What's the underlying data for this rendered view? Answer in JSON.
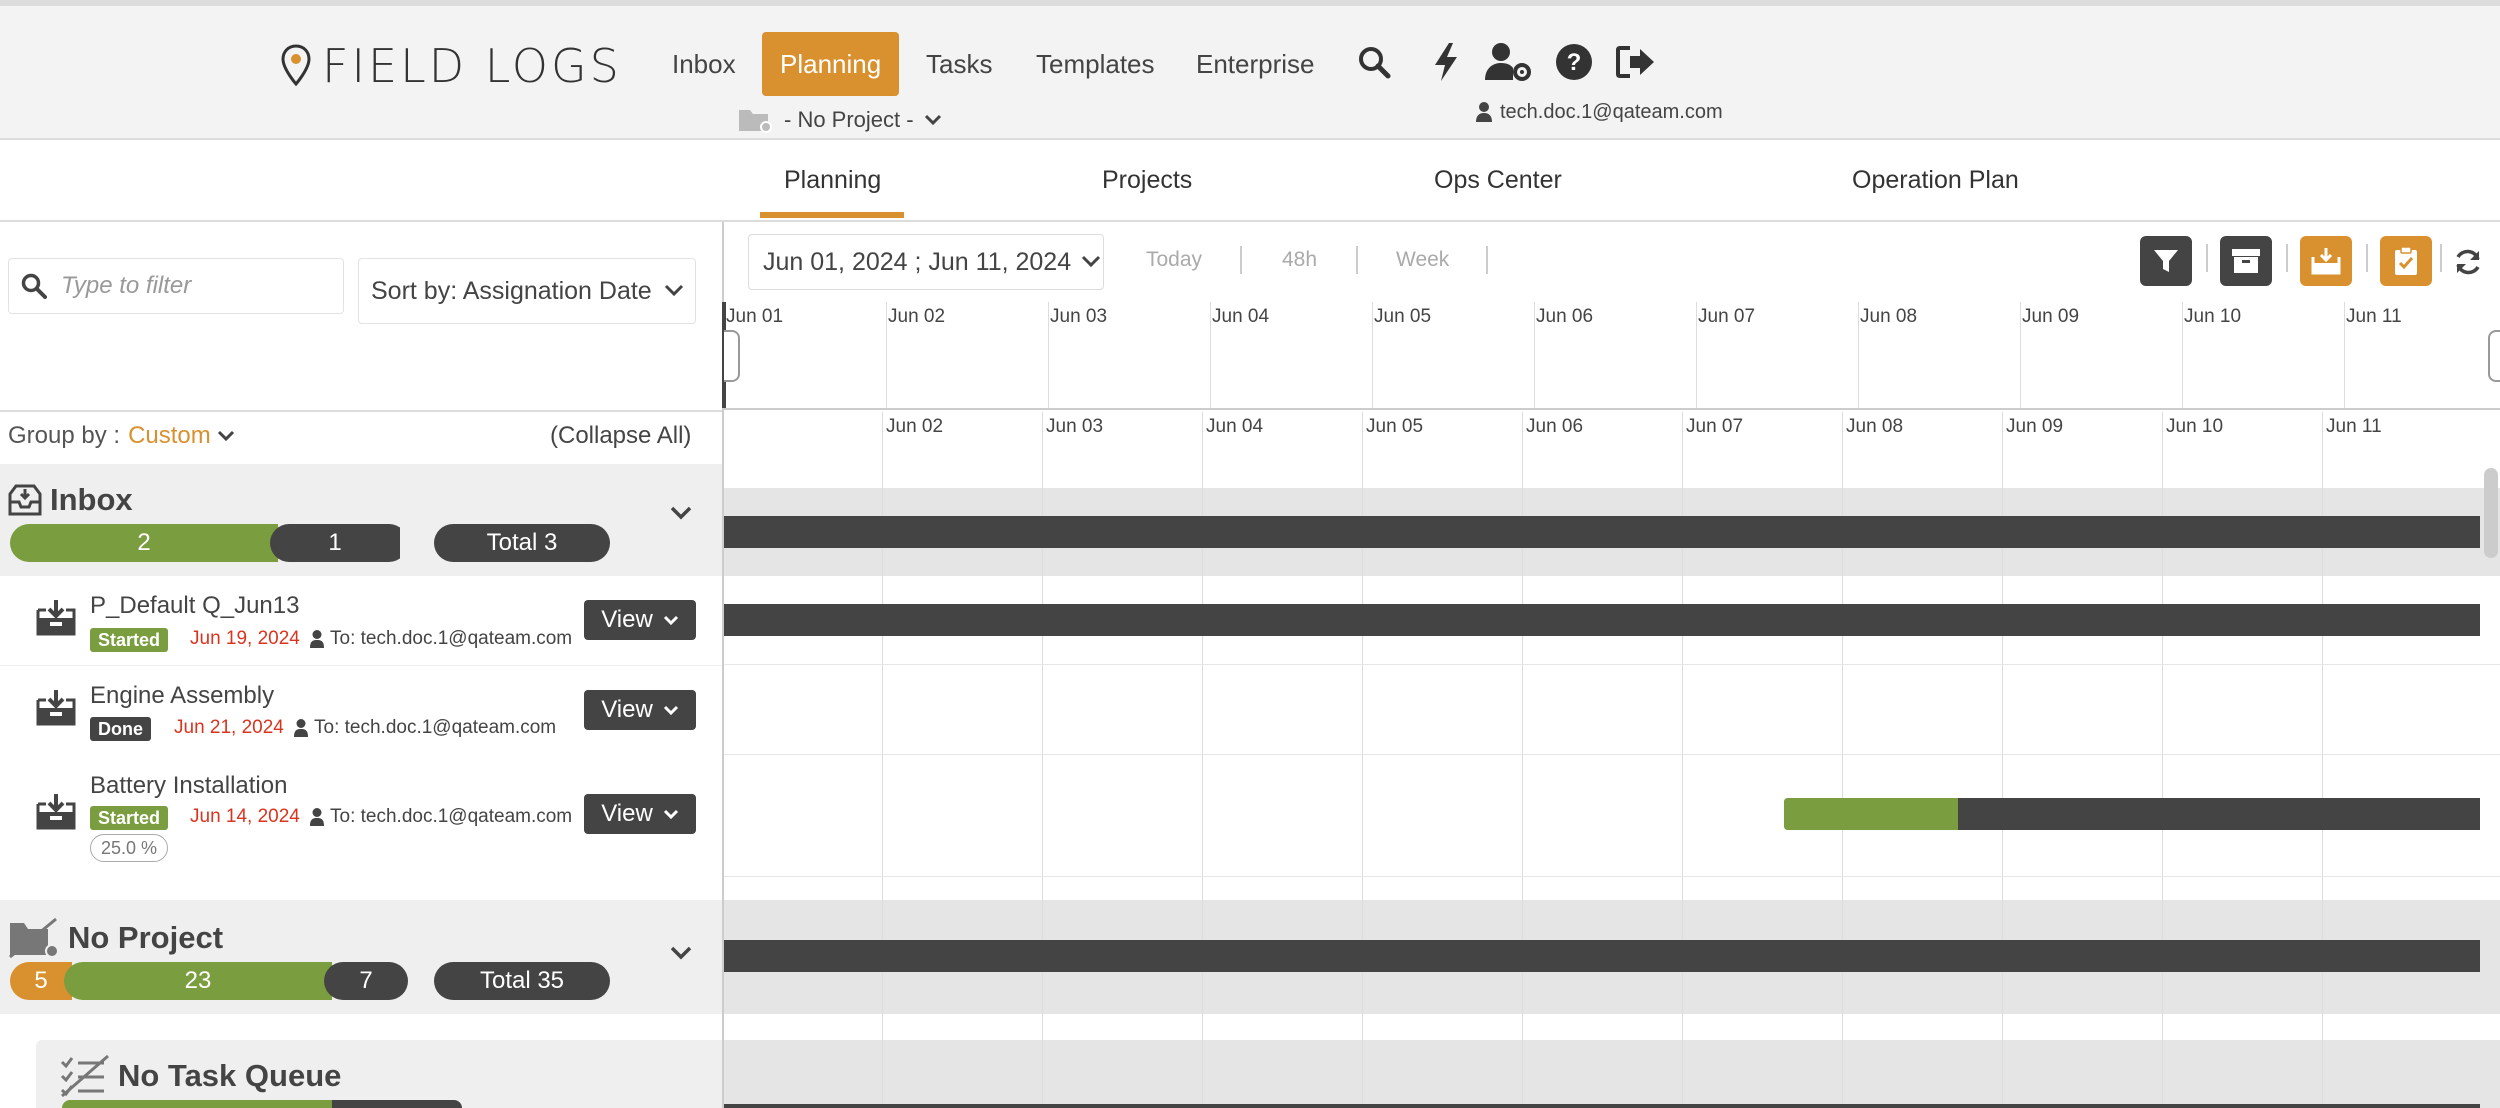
{
  "header": {
    "logo_text": "FIELD LOGS",
    "nav": [
      {
        "label": "Inbox",
        "active": false
      },
      {
        "label": "Planning",
        "active": true
      },
      {
        "label": "Tasks",
        "active": false
      },
      {
        "label": "Templates",
        "active": false
      },
      {
        "label": "Enterprise",
        "active": false
      }
    ],
    "icons": [
      "search-icon",
      "bolt-icon",
      "user-settings-icon",
      "help-icon",
      "logout-icon"
    ],
    "project_selector": "- No Project -",
    "user_email": "tech.doc.1@qateam.com"
  },
  "subnav": {
    "tabs": [
      {
        "label": "Planning",
        "active": true
      },
      {
        "label": "Projects",
        "active": false
      },
      {
        "label": "Ops Center",
        "active": false
      },
      {
        "label": "Operation Plan",
        "active": false
      }
    ]
  },
  "left": {
    "filter_placeholder": "Type to filter",
    "sort_label": "Sort by: Assignation Date",
    "groupby_label": "Group by :",
    "groupby_value": "Custom",
    "collapse_all": "(Collapse All)",
    "groups": {
      "inbox": {
        "title": "Inbox",
        "segments": [
          {
            "value": "2",
            "color": "#7a9e3f"
          },
          {
            "value": "1",
            "color": "#444444"
          }
        ],
        "total": "Total 3",
        "tasks": [
          {
            "title": "P_Default Q_Jun13",
            "status": "Started",
            "date": "Jun 19, 2024",
            "to": "To: tech.doc.1@qateam.com"
          },
          {
            "title": "Engine Assembly",
            "status": "Done",
            "date": "Jun 21, 2024",
            "to": "To: tech.doc.1@qateam.com"
          },
          {
            "title": "Battery Installation",
            "status": "Started",
            "date": "Jun 14, 2024",
            "to": "To: tech.doc.1@qateam.com",
            "progress": "25.0 %"
          }
        ]
      },
      "no_project": {
        "title": "No Project",
        "segments": [
          {
            "value": "5",
            "color": "#d9912f"
          },
          {
            "value": "23",
            "color": "#7a9e3f"
          },
          {
            "value": "7",
            "color": "#444444"
          }
        ],
        "total": "Total 35"
      },
      "no_task_queue": {
        "title": "No Task Queue"
      }
    },
    "view_label": "View"
  },
  "gantt": {
    "date_range": "Jun 01, 2024 ; Jun 11, 2024",
    "range_buttons": [
      "Today",
      "48h",
      "Week"
    ],
    "timeline_days": [
      "Jun 01",
      "Jun 02",
      "Jun 03",
      "Jun 04",
      "Jun 05",
      "Jun 06",
      "Jun 07",
      "Jun 08",
      "Jun 09",
      "Jun 10",
      "Jun 11"
    ],
    "grid_days": [
      "Jun 02",
      "Jun 03",
      "Jun 04",
      "Jun 05",
      "Jun 06",
      "Jun 07",
      "Jun 08",
      "Jun 09",
      "Jun 10",
      "Jun 11"
    ],
    "colors": {
      "accent": "#d9912f",
      "green": "#7a9e3f",
      "dark": "#444444"
    }
  }
}
